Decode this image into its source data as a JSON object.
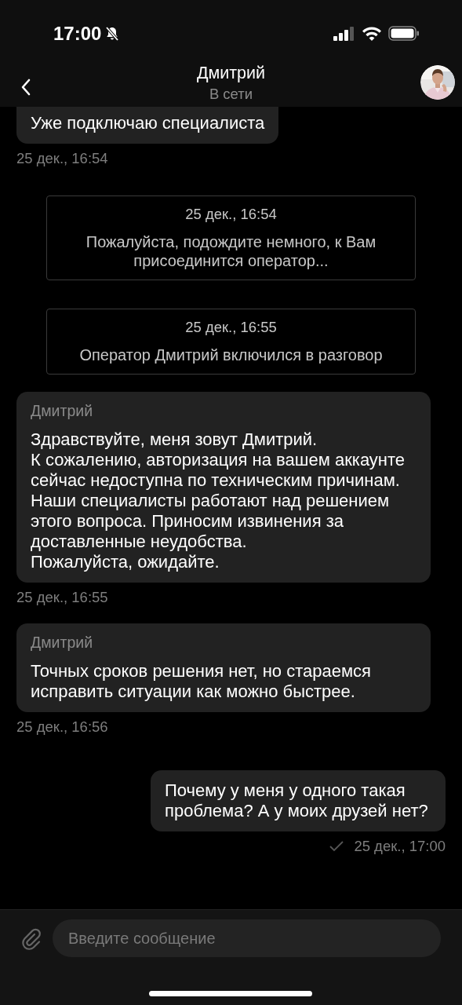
{
  "status_bar": {
    "time": "17:00",
    "silent": true
  },
  "header": {
    "title": "Дмитрий",
    "status": "В сети"
  },
  "messages": [
    {
      "kind": "incoming",
      "text": "Уже подключаю специалиста",
      "time": "25 дек., 16:54"
    },
    {
      "kind": "system",
      "time": "25 дек., 16:54",
      "text": "Пожалуйста, подождите немного, к Вам присоединится оператор..."
    },
    {
      "kind": "system",
      "time": "25 дек., 16:55",
      "text": "Оператор Дмитрий включился в разговор"
    },
    {
      "kind": "incoming",
      "sender": "Дмитрий",
      "text": "Здравствуйте, меня зовут Дмитрий.\nК сожалению, авторизация на вашем аккаунте сейчас недоступна по техническим причинам. Наши специалисты работают над решением этого вопроса. Приносим извинения за доставленные неудобства.\nПожалуйста, ожидайте.",
      "time": "25 дек., 16:55"
    },
    {
      "kind": "incoming",
      "sender": "Дмитрий",
      "text": "Точных сроков решения нет, но стараемся исправить ситуации как можно быстрее.",
      "time": "25 дек., 16:56"
    },
    {
      "kind": "outgoing",
      "text": "Почему у меня у одного такая проблема? А у моих друзей нет?",
      "time": "25 дек., 17:00",
      "delivered": true
    }
  ],
  "composer": {
    "placeholder": "Введите сообщение"
  }
}
